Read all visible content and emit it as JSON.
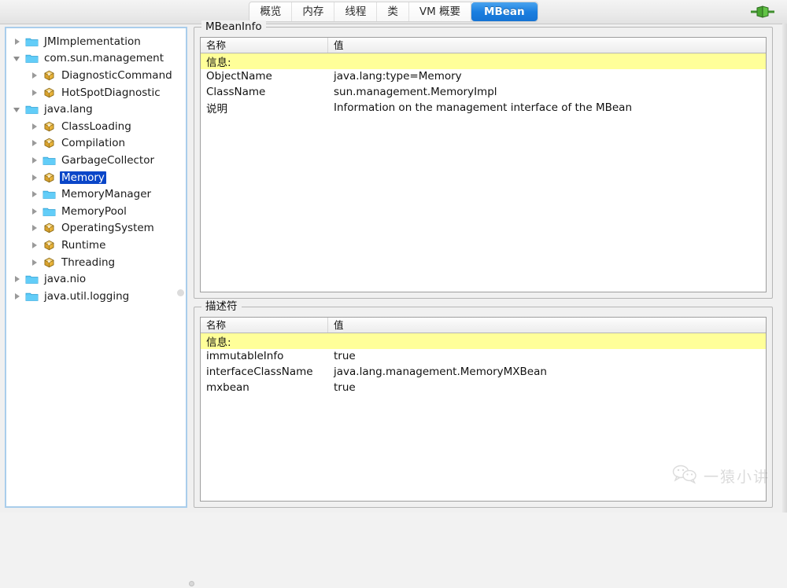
{
  "window": {
    "app": "JConsole",
    "connection_icon": "connection-plug-icon"
  },
  "tabs": [
    {
      "label": "概览",
      "active": false
    },
    {
      "label": "内存",
      "active": false
    },
    {
      "label": "线程",
      "active": false
    },
    {
      "label": "类",
      "active": false
    },
    {
      "label": "VM 概要",
      "active": false
    },
    {
      "label": "MBean",
      "active": true
    }
  ],
  "tree": {
    "nodes": [
      {
        "label": "JMImplementation",
        "depth": 0,
        "icon": "folder-icon",
        "state": "closed",
        "selected": false
      },
      {
        "label": "com.sun.management",
        "depth": 0,
        "icon": "folder-icon",
        "state": "open",
        "selected": false
      },
      {
        "label": "DiagnosticCommand",
        "depth": 1,
        "icon": "mbean-icon",
        "state": "closed",
        "selected": false
      },
      {
        "label": "HotSpotDiagnostic",
        "depth": 1,
        "icon": "mbean-icon",
        "state": "closed",
        "selected": false
      },
      {
        "label": "java.lang",
        "depth": 0,
        "icon": "folder-icon",
        "state": "open",
        "selected": false
      },
      {
        "label": "ClassLoading",
        "depth": 1,
        "icon": "mbean-icon",
        "state": "closed",
        "selected": false
      },
      {
        "label": "Compilation",
        "depth": 1,
        "icon": "mbean-icon",
        "state": "closed",
        "selected": false
      },
      {
        "label": "GarbageCollector",
        "depth": 1,
        "icon": "folder-icon",
        "state": "closed",
        "selected": false
      },
      {
        "label": "Memory",
        "depth": 1,
        "icon": "mbean-icon",
        "state": "closed",
        "selected": true
      },
      {
        "label": "MemoryManager",
        "depth": 1,
        "icon": "folder-icon",
        "state": "closed",
        "selected": false
      },
      {
        "label": "MemoryPool",
        "depth": 1,
        "icon": "folder-icon",
        "state": "closed",
        "selected": false
      },
      {
        "label": "OperatingSystem",
        "depth": 1,
        "icon": "mbean-icon",
        "state": "closed",
        "selected": false
      },
      {
        "label": "Runtime",
        "depth": 1,
        "icon": "mbean-icon",
        "state": "closed",
        "selected": false
      },
      {
        "label": "Threading",
        "depth": 1,
        "icon": "mbean-icon",
        "state": "closed",
        "selected": false
      },
      {
        "label": "java.nio",
        "depth": 0,
        "icon": "folder-icon",
        "state": "closed",
        "selected": false
      },
      {
        "label": "java.util.logging",
        "depth": 0,
        "icon": "folder-icon",
        "state": "closed",
        "selected": false
      }
    ]
  },
  "mbean_info": {
    "title": "MBeanInfo",
    "columns": [
      "名称",
      "值"
    ],
    "section_label": "信息:",
    "rows": [
      {
        "name": "ObjectName",
        "value": "java.lang:type=Memory"
      },
      {
        "name": "ClassName",
        "value": "sun.management.MemoryImpl"
      },
      {
        "name": "说明",
        "value": "Information on the management interface of the MBean"
      }
    ]
  },
  "descriptor": {
    "title": "描述符",
    "columns": [
      "名称",
      "值"
    ],
    "section_label": "信息:",
    "rows": [
      {
        "name": "immutableInfo",
        "value": "true"
      },
      {
        "name": "interfaceClassName",
        "value": "java.lang.management.MemoryMXBean"
      },
      {
        "name": "mxbean",
        "value": "true"
      }
    ]
  },
  "watermark": {
    "icon": "wechat-icon",
    "text": "一猿小讲"
  },
  "colors": {
    "accent": "#1b7fe0",
    "selection": "#0a46c8",
    "section_highlight": "#ffff99",
    "folder": "#5bc8f5",
    "mbean": "#e8b33a",
    "panel_border": "#a9cdeb"
  }
}
